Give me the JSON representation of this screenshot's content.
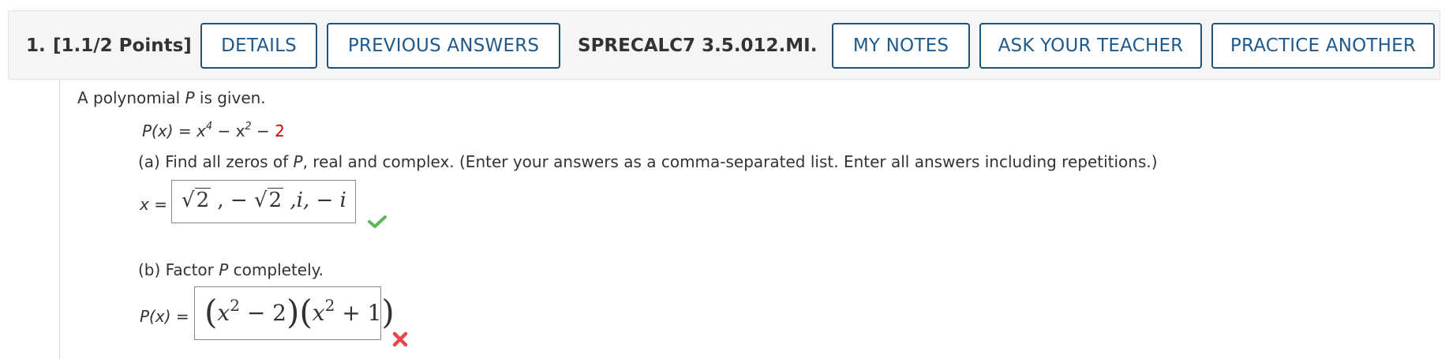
{
  "header": {
    "question_number": "1.",
    "points": "[1.1/2 Points]",
    "details_label": "DETAILS",
    "previous_answers_label": "PREVIOUS ANSWERS",
    "problem_code": "SPRECALC7 3.5.012.MI.",
    "my_notes_label": "MY NOTES",
    "ask_teacher_label": "ASK YOUR TEACHER",
    "practice_another_label": "PRACTICE ANOTHER"
  },
  "question": {
    "intro_prefix": "A polynomial ",
    "intro_var": "P",
    "intro_suffix": " is given.",
    "poly_lhs": "P(x) = x",
    "poly_exp1": "4",
    "poly_mid": " − x",
    "poly_exp2": "2",
    "poly_minus": " − ",
    "poly_const": "2",
    "part_a_prefix": "(a) Find all zeros of ",
    "part_a_var": "P",
    "part_a_suffix": ", real and complex. (Enter your answers as a comma-separated list. Enter all answers including repetitions.)",
    "part_a_lhs": "x =",
    "part_b_prefix": "(b) Factor ",
    "part_b_var": "P",
    "part_b_suffix": " completely.",
    "part_b_lhs": "P(x) ="
  },
  "answer_a": {
    "sqrt_arg1": "2",
    "sep1": " ,  − ",
    "sqrt_arg2": "2",
    "rest": " ,i,  − i",
    "status_icon": "checkmark-icon",
    "status_color": "#5cb85c"
  },
  "answer_b": {
    "paren1_open": "(",
    "term1": "x",
    "term1_exp": "2",
    "term1_rest": " − 2",
    "paren1_close": ")",
    "paren2_open": "(",
    "term2": "x",
    "term2_exp": "2",
    "term2_rest": " + 1",
    "paren2_close": ")",
    "status_icon": "cross-icon",
    "status_color": "#e8474d"
  },
  "colors": {
    "button_border": "#1f5478",
    "button_text": "#1f5a8a",
    "header_bg": "#f5f5f5",
    "highlight_red": "#d40000"
  }
}
